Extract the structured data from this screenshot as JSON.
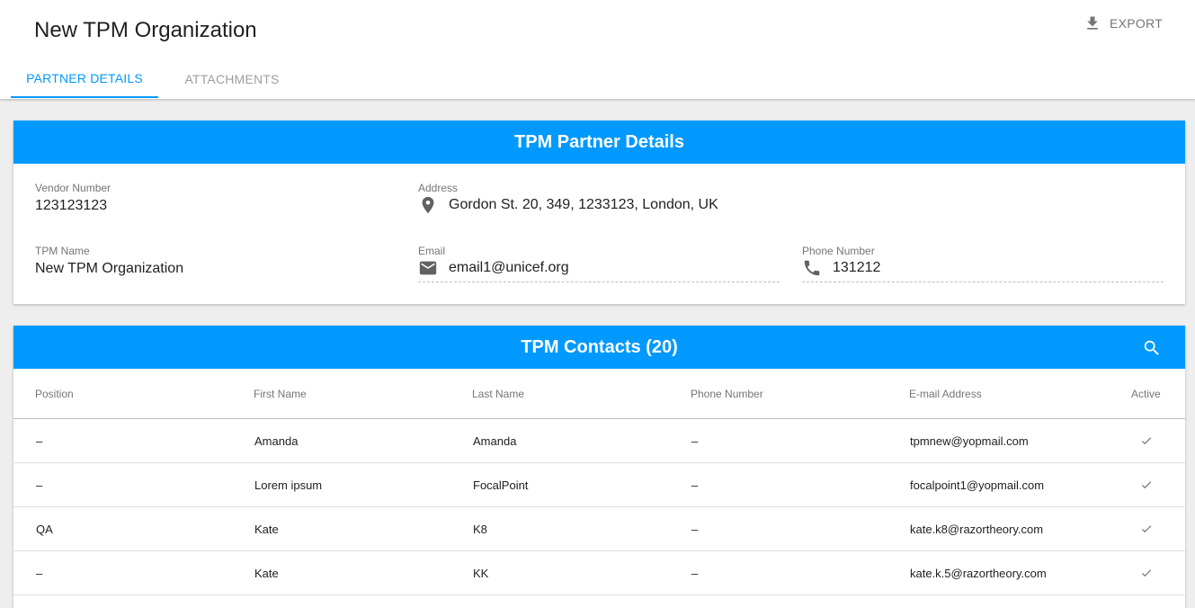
{
  "header": {
    "title": "New TPM Organization",
    "export_label": "EXPORT"
  },
  "tabs": [
    {
      "label": "PARTNER DETAILS",
      "active": true
    },
    {
      "label": "ATTACHMENTS",
      "active": false
    }
  ],
  "partner_details": {
    "title": "TPM Partner Details",
    "vendor_number": {
      "label": "Vendor Number",
      "value": "123123123"
    },
    "address": {
      "label": "Address",
      "value": "Gordon St. 20, 349, 1233123, London, UK",
      "icon": "location-pin-icon"
    },
    "tpm_name": {
      "label": "TPM Name",
      "value": "New TPM Organization"
    },
    "email": {
      "label": "Email",
      "value": "email1@unicef.org",
      "icon": "email-icon"
    },
    "phone": {
      "label": "Phone Number",
      "value": "131212",
      "icon": "phone-icon"
    }
  },
  "contacts": {
    "title": "TPM Contacts (20)",
    "columns": [
      "Position",
      "First Name",
      "Last Name",
      "Phone Number",
      "E-mail Address",
      "Active"
    ],
    "rows": [
      {
        "position": "–",
        "first_name": "Amanda",
        "last_name": "Amanda",
        "phone": "–",
        "email": "tpmnew@yopmail.com",
        "active": true
      },
      {
        "position": "–",
        "first_name": "Lorem ipsum",
        "last_name": "FocalPoint",
        "phone": "–",
        "email": "focalpoint1@yopmail.com",
        "active": true
      },
      {
        "position": "QA",
        "first_name": "Kate",
        "last_name": "K8",
        "phone": "–",
        "email": "kate.k8@razortheory.com",
        "active": true
      },
      {
        "position": "–",
        "first_name": "Kate",
        "last_name": "KK",
        "phone": "–",
        "email": "kate.k.5@razortheory.com",
        "active": true
      }
    ]
  },
  "colors": {
    "accent": "#0099ff",
    "text": "#212121",
    "muted": "#757575"
  }
}
